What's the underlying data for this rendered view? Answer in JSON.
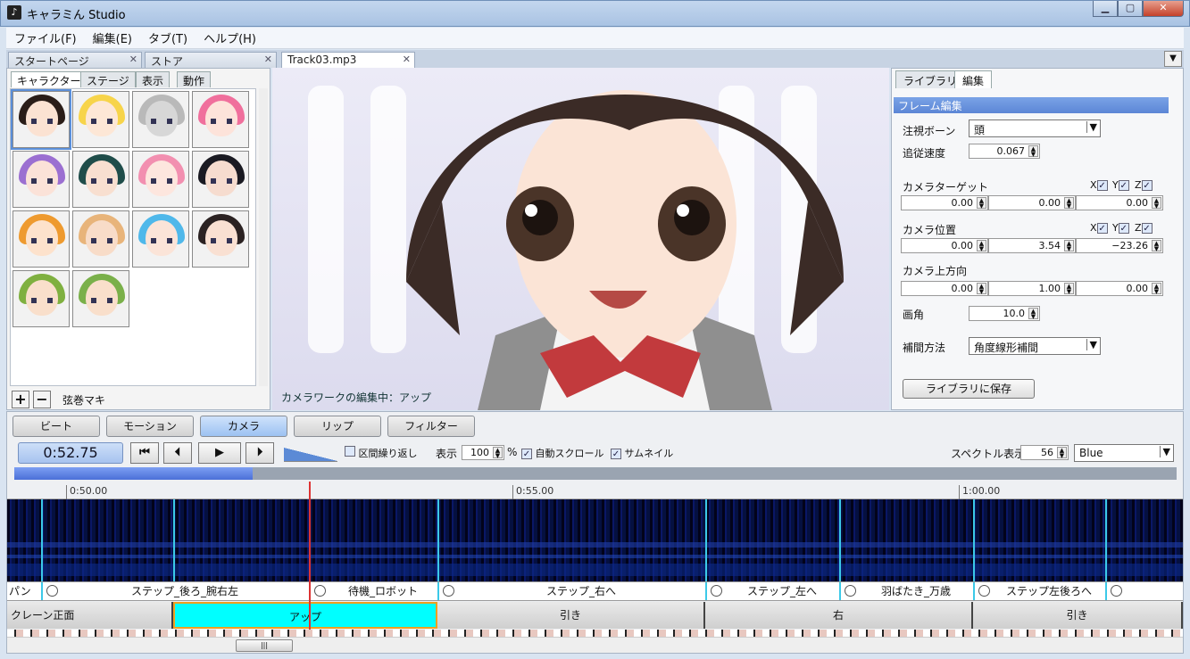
{
  "window": {
    "title": "キャラミん Studio",
    "icon": "note-icon"
  },
  "menu": [
    "ファイル(F)",
    "編集(E)",
    "タブ(T)",
    "ヘルプ(H)"
  ],
  "doc_tabs": [
    {
      "label": "スタートページ",
      "active": false
    },
    {
      "label": "ストア",
      "active": false
    },
    {
      "label": "Track03.mp3",
      "active": true
    }
  ],
  "left_tabs": [
    "キャラクター",
    "ステージ",
    "表示",
    "動作"
  ],
  "characters": [
    {
      "hair": "#2a1d18",
      "face": "#fbe2d2"
    },
    {
      "hair": "#f7d44a",
      "face": "#fde7d6"
    },
    {
      "hair": "#b9b9b9",
      "face": "#d7d7d7"
    },
    {
      "hair": "#f06f9c",
      "face": "#fde3da"
    },
    {
      "hair": "#9b6fd1",
      "face": "#fbe2d8"
    },
    {
      "hair": "#1f4d4a",
      "face": "#f8dfd0"
    },
    {
      "hair": "#f28fb0",
      "face": "#fde6de"
    },
    {
      "hair": "#1a1a22",
      "face": "#f6dccf"
    },
    {
      "hair": "#ee9a2f",
      "face": "#fde2cc"
    },
    {
      "hair": "#e8b47a",
      "face": "#f8dcc8"
    },
    {
      "hair": "#4fb8ea",
      "face": "#fbe4d8"
    },
    {
      "hair": "#2b2222",
      "face": "#f9e0d2"
    },
    {
      "hair": "#7fb040",
      "face": "#f9dfcb"
    },
    {
      "hair": "#7ab04a",
      "face": "#f9dfcb"
    }
  ],
  "selected_character": "弦巻マキ",
  "viewport": {
    "caption": "カメラワークの編集中：アップ"
  },
  "right_tabs": [
    {
      "label": "ライブラリ",
      "active": false
    },
    {
      "label": "編集",
      "active": true
    }
  ],
  "frame_edit": {
    "header": "フレーム編集",
    "gaze_bone_label": "注視ボーン",
    "gaze_bone_value": "頭",
    "follow_speed_label": "追従速度",
    "follow_speed": "0.067",
    "camera_target_label": "カメラターゲット",
    "camera_target": [
      "0.00",
      "0.00",
      "0.00"
    ],
    "camera_pos_label": "カメラ位置",
    "camera_pos": [
      "0.00",
      "3.54",
      "−23.26"
    ],
    "camera_up_label": "カメラ上方向",
    "camera_up": [
      "0.00",
      "1.00",
      "0.00"
    ],
    "fov_label": "画角",
    "fov": "10.0",
    "interp_label": "補間方法",
    "interp_value": "角度線形補間",
    "axes": [
      "X",
      "Y",
      "Z"
    ],
    "save_button": "ライブラリに保存"
  },
  "bottom_tabs": [
    {
      "label": "ビート",
      "active": false
    },
    {
      "label": "モーション",
      "active": false
    },
    {
      "label": "カメラ",
      "active": true
    },
    {
      "label": "リップ",
      "active": false
    },
    {
      "label": "フィルター",
      "active": false
    }
  ],
  "transport": {
    "time": "0:52.75",
    "loop_label": "区間繰り返し",
    "display_label": "表示",
    "zoom": "100",
    "zoom_unit": "%",
    "autoscroll_label": "自動スクロール",
    "thumbnail_label": "サムネイル",
    "spectrum_label": "スペクトル表示",
    "spectrum_value": "56",
    "color_value": "Blue"
  },
  "progress": 0.205,
  "ruler": [
    "0:50.00",
    "0:55.00",
    "1:00.00"
  ],
  "motion_clips": [
    {
      "label": "パンチ",
      "circle": false
    },
    {
      "label": "ステップ_後ろ_腕右左",
      "circle": true
    },
    {
      "label": "待機_ロボット",
      "circle": true
    },
    {
      "label": "ステップ_右へ",
      "circle": true
    },
    {
      "label": "ステップ_左へ",
      "circle": true
    },
    {
      "label": "羽ばたき_万歳",
      "circle": true
    },
    {
      "label": "ステップ左後ろへ",
      "circle": true
    },
    {
      "label": "",
      "circle": true
    }
  ],
  "camera_clips": [
    {
      "label": "クレーン正面",
      "active": false
    },
    {
      "label": "アップ",
      "active": true
    },
    {
      "label": "引き",
      "active": false
    },
    {
      "label": "右",
      "active": false
    },
    {
      "label": "引き",
      "active": false
    }
  ]
}
